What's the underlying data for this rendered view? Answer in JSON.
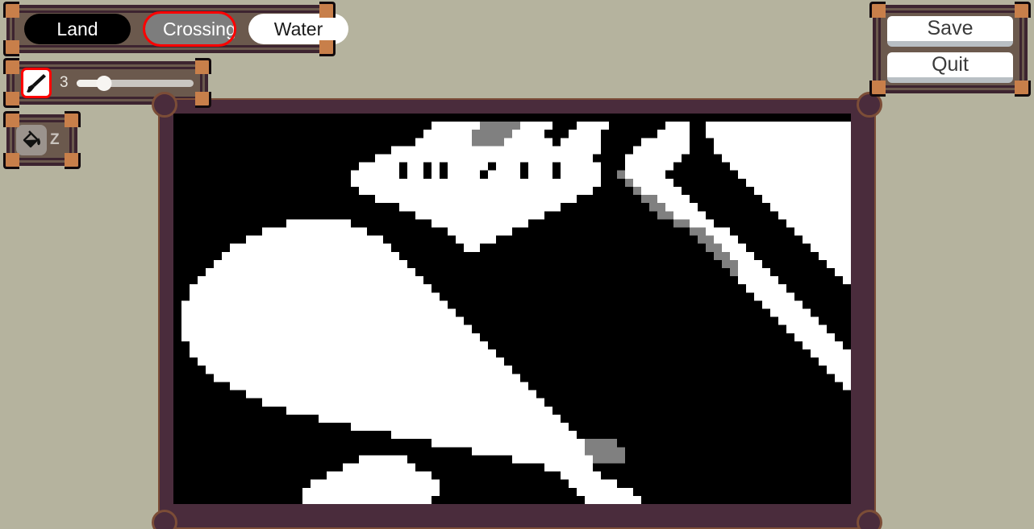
{
  "app": {
    "background_color": "#b5b39e",
    "panel_fill": "#6b594d",
    "panel_border": "#3d2430",
    "corner_accent": "#c87f4a",
    "selection_color": "#ff0000"
  },
  "terrain_selector": {
    "name": "terrain-type-selector",
    "selected": "Crossing",
    "options": [
      {
        "label": "Land",
        "fill": "#000000",
        "text": "#ffffff",
        "selected": false
      },
      {
        "label": "Crossing",
        "fill": "#7d7d7d",
        "text": "#ffffff",
        "selected": true
      },
      {
        "label": "Water",
        "fill": "#ffffff",
        "text": "#1a1a1a",
        "selected": false
      }
    ]
  },
  "brush": {
    "name": "brush-size-control",
    "tool_icon": "paintbrush-icon",
    "size_value": "3",
    "slider_min": 1,
    "slider_max": 10,
    "slider_value": 3,
    "slider_percent": 24,
    "selected": true
  },
  "tools": {
    "name": "tool-palette",
    "items": [
      {
        "icon": "paint-bucket-icon",
        "shortcut": "Z",
        "selected": false
      }
    ]
  },
  "actions": {
    "save_label": "Save",
    "quit_label": "Quit"
  },
  "map": {
    "name": "terrain-map-canvas",
    "frame_color": "#4a2c3c",
    "frame_edge_color": "#7c4d37",
    "cell_size": 10,
    "cols": 84,
    "rows": 48,
    "palette": {
      "water": "#000000",
      "land": "#ffffff",
      "crossing": "#808080"
    },
    "legend_note": "0 = water (black), 1 = land (white), 2 = crossing (gray)",
    "grid": [
      "000000000000000000000000000000000000000000000000000000000000000000000000000000000000",
      "000000000000000000000000000000001111112222211110001111000000011100111111111111111111",
      "000000000000000000000000000000011111122222111100011110000000111100111111111111111111",
      "000000000000000000000000000000111111122221111110111110000011111100011111111111111111",
      "000000000000000000000000000111111111111111111111111110000111111100011111111111111111",
      "000000000000000000000000011111111111111111111111111100001111111000001111111111111111",
      "000000000000000000000001111101101011111011101110111110001111110000000111111111111111",
      "000000000000000000000011111101101011110111101110111110021111100000000011111111111111",
      "000000000000000000000011111111111111111111111111111110002111110000000001111111111111",
      "000000000000000000000001111111111111111111111111111100000211111000000000111111111111",
      "000000000000000000000000011111111111111111111111110000000022111100000000011111111111",
      "000000000000000000000000000011111111111111111111000000000002211110000000001111111111",
      "000000000000000000000000000000111111111111111100000000000000221111000000000111111111",
      "000000000000001111111100000000001111111111110000000000000000002211100000000011111111",
      "000000000001111111111111000000000011111111000000000000000000000022111000000001111111",
      "000000000111111111111111110000000001111100000000000000000000000002211100000000111111",
      "000000011111111111111111111000000000110000000000000000000000000000221110000000011111",
      "000000111111111111111111111100000000000000000000000000000000000000022111000000001111",
      "000001111111111111111111111110000000000000000000000000000000000000002211100000000111",
      "000011111111111111111111111111000000000000000000000000000000000000000211110000000011",
      "000111111111111111111111111111100000000000000000000000000000000000000011111000000001",
      "001111111111111111111111111111110000000000000000000000000000000000000001111100000000",
      "001111111111111111111111111111111000000000000000000000000000000000000000111110000000",
      "011111111111111111111111111111111100000000000000000000000000000000000000011111000000",
      "011111111111111111111111111111111110000000000000000000000000000000000000001111100000",
      "011111111111111111111111111111111111000000000000000000000000000000000000000111110000",
      "011111111111111111111111111111111111100000000000000000000000000000000000000011111000",
      "011111111111111111111111111111111111110000000000000000000000000000000000000001111100",
      "001111111111111111111111111111111111111000000000000000000000000000000000000000111110",
      "001111111111111111111111111111111111111100000000000000000000000000000000000000011111",
      "000111111111111111111111111111111111111110000000000000000000000000000000000000001111",
      "000011111111111111111111111111111111111111000000000000000000000000000000000000000111",
      "000001111111111111111111111111111111111111100000000000000000000000000000000000000011",
      "000000011111111111111111111111111111111111110000000000000000000000000000000000000001",
      "000000000111111111111111111111111111111111111000000000000000000000000000000000000000",
      "000000000001111111111111111111111111111111111100000000000000000000000000000000000000",
      "000000000000001111111111111111111111111111111110000000000000000000000000000000000000",
      "000000000000000000111111111111111111111111111111000000000000000000000000000000000000",
      "000000000000000000000011111111111111111111111111100000000000000000000000000000000000",
      "000000000000000000000000000111111111111111111111110000000000000000000000000000000000",
      "000000000000000000000000000000001111111111111111111222200000000000000000000000000000",
      "000000000000000000000000000000000000011111111111111222220000000000000000000000000000",
      "000000000000000000000001111110000000000000111111111122220000000000000000000000000000",
      "000000000000000000000111111111000000000000000011111100000000000000000000000000000000",
      "000000000000000000011111111111110000000000000000111110000000000000000000000000000000",
      "000000000000000001111111111111111000000000000000011111100000000000000000000000000000",
      "000000000000000011111111111111111000000000000000001111111000000000000000000000000000",
      "000000000000000011111111111111110000000000000000000111111100000000000000000000000000"
    ]
  }
}
